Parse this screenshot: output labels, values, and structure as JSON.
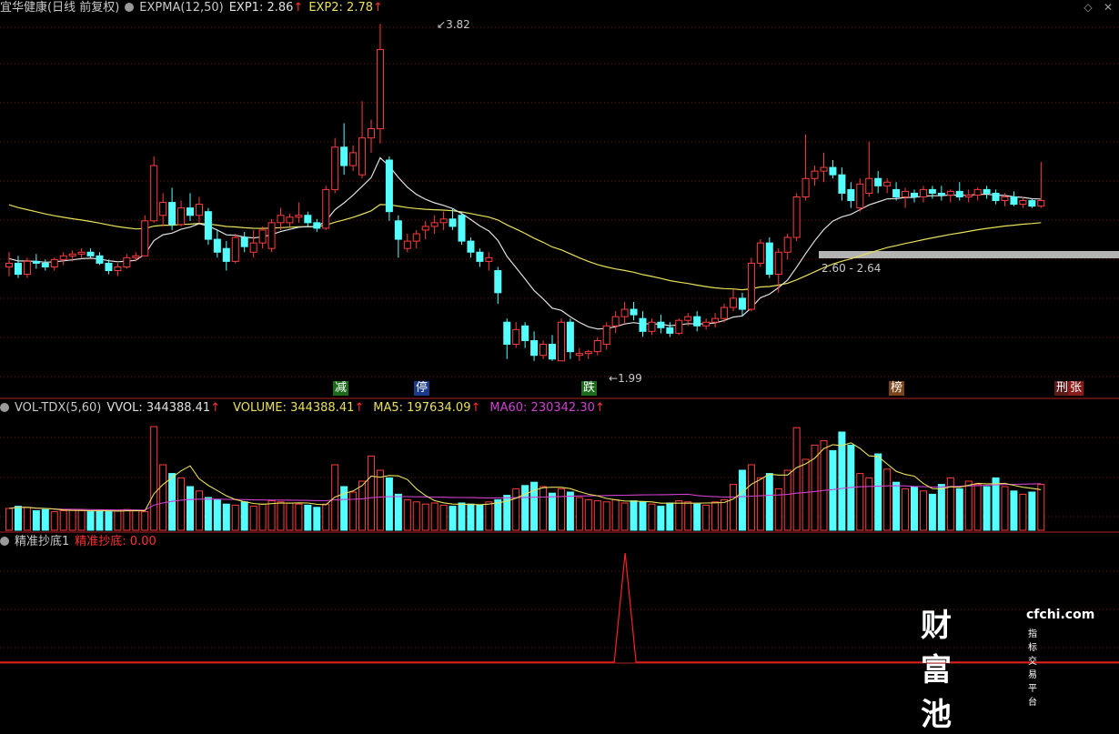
{
  "top_bar": {
    "stock_name": "宜华健康(日线 前复权)",
    "indicator": "EXPMA(12,50)",
    "exp1": "EXP1: 2.86",
    "exp2": "EXP2: 2.78",
    "up_arrow": "↑",
    "max_icon": "max-icon",
    "close_icon": "close-icon"
  },
  "price_annotations": {
    "high": "3.82",
    "low": "1.99",
    "range": "2.60 - 2.64"
  },
  "event_markers": [
    {
      "label": "减",
      "kind": "reduce"
    },
    {
      "label": "停",
      "kind": "halt"
    },
    {
      "label": "跌",
      "kind": "drop"
    },
    {
      "label": "榜",
      "kind": "list"
    },
    {
      "label": "刑",
      "kind": "penal"
    },
    {
      "label": "张",
      "kind": "rise"
    }
  ],
  "volume_bar": {
    "indicator": "VOL-TDX(5,60)",
    "vvol": "VVOL: 344388.41",
    "volume": "VOLUME: 344388.41",
    "ma5": "MA5: 197634.09",
    "ma60": "MA60: 230342.30"
  },
  "signal_bar": {
    "indicator": "精准抄底1",
    "value": "精准抄底: 0.00"
  },
  "watermark": {
    "brand": "财富池",
    "url": "cfchi.com",
    "tagline": "指标交易平台"
  },
  "colors": {
    "up": "#ff3c3c",
    "down": "#54ffff",
    "exp1": "#e0e0e0",
    "exp2": "#e8e05a",
    "ma60": "#d040d0",
    "signal": "#ff2020",
    "highlight_band": "#b4b4b4"
  },
  "chart_data": {
    "type": "candlestick",
    "ohlc": [
      [
        2.5,
        2.58,
        2.45,
        2.52
      ],
      [
        2.52,
        2.56,
        2.44,
        2.46
      ],
      [
        2.46,
        2.55,
        2.44,
        2.53
      ],
      [
        2.53,
        2.57,
        2.49,
        2.52
      ],
      [
        2.52,
        2.54,
        2.48,
        2.5
      ],
      [
        2.5,
        2.55,
        2.48,
        2.54
      ],
      [
        2.54,
        2.58,
        2.51,
        2.56
      ],
      [
        2.56,
        2.59,
        2.53,
        2.57
      ],
      [
        2.57,
        2.6,
        2.55,
        2.58
      ],
      [
        2.58,
        2.6,
        2.55,
        2.56
      ],
      [
        2.56,
        2.58,
        2.51,
        2.52
      ],
      [
        2.52,
        2.54,
        2.46,
        2.48
      ],
      [
        2.48,
        2.52,
        2.45,
        2.5
      ],
      [
        2.5,
        2.57,
        2.49,
        2.55
      ],
      [
        2.55,
        2.58,
        2.53,
        2.56
      ],
      [
        2.56,
        2.78,
        2.56,
        2.75
      ],
      [
        2.75,
        3.1,
        2.74,
        3.05
      ],
      [
        2.78,
        2.9,
        2.72,
        2.85
      ],
      [
        2.85,
        2.93,
        2.7,
        2.73
      ],
      [
        2.73,
        2.86,
        2.72,
        2.82
      ],
      [
        2.82,
        2.9,
        2.75,
        2.78
      ],
      [
        2.78,
        2.88,
        2.74,
        2.84
      ],
      [
        2.8,
        2.82,
        2.62,
        2.65
      ],
      [
        2.65,
        2.7,
        2.55,
        2.58
      ],
      [
        2.6,
        2.64,
        2.48,
        2.53
      ],
      [
        2.53,
        2.68,
        2.52,
        2.66
      ],
      [
        2.66,
        2.69,
        2.58,
        2.61
      ],
      [
        2.58,
        2.7,
        2.55,
        2.63
      ],
      [
        2.63,
        2.72,
        2.6,
        2.7
      ],
      [
        2.6,
        2.76,
        2.58,
        2.74
      ],
      [
        2.74,
        2.82,
        2.7,
        2.78
      ],
      [
        2.74,
        2.79,
        2.72,
        2.77
      ],
      [
        2.77,
        2.85,
        2.74,
        2.78
      ],
      [
        2.78,
        2.8,
        2.72,
        2.74
      ],
      [
        2.74,
        2.76,
        2.69,
        2.71
      ],
      [
        2.71,
        2.94,
        2.7,
        2.92
      ],
      [
        2.92,
        3.2,
        2.9,
        3.15
      ],
      [
        3.15,
        3.28,
        3.0,
        3.05
      ],
      [
        3.05,
        3.16,
        3.02,
        3.12
      ],
      [
        3.0,
        3.4,
        2.98,
        3.2
      ],
      [
        3.2,
        3.3,
        3.12,
        3.25
      ],
      [
        3.25,
        3.82,
        3.17,
        3.68
      ],
      [
        3.08,
        3.1,
        2.75,
        2.8
      ],
      [
        2.75,
        2.78,
        2.55,
        2.65
      ],
      [
        2.6,
        2.68,
        2.58,
        2.64
      ],
      [
        2.64,
        2.7,
        2.6,
        2.68
      ],
      [
        2.7,
        2.75,
        2.65,
        2.72
      ],
      [
        2.72,
        2.78,
        2.68,
        2.74
      ],
      [
        2.74,
        2.8,
        2.7,
        2.76
      ],
      [
        2.76,
        2.82,
        2.7,
        2.72
      ],
      [
        2.78,
        2.8,
        2.62,
        2.64
      ],
      [
        2.64,
        2.66,
        2.55,
        2.58
      ],
      [
        2.58,
        2.6,
        2.5,
        2.53
      ],
      [
        2.53,
        2.58,
        2.48,
        2.55
      ],
      [
        2.48,
        2.5,
        2.3,
        2.36
      ],
      [
        2.2,
        2.22,
        2.0,
        2.08
      ],
      [
        2.08,
        2.2,
        2.06,
        2.16
      ],
      [
        2.18,
        2.2,
        2.06,
        2.1
      ],
      [
        2.1,
        2.15,
        1.99,
        2.02
      ],
      [
        2.02,
        2.1,
        2.0,
        2.08
      ],
      [
        2.08,
        2.13,
        1.99,
        2.0
      ],
      [
        1.99,
        2.22,
        1.99,
        2.2
      ],
      [
        2.2,
        2.22,
        2.0,
        2.04
      ],
      [
        2.02,
        2.06,
        1.99,
        2.03
      ],
      [
        2.03,
        2.05,
        2.0,
        2.04
      ],
      [
        2.04,
        2.12,
        2.02,
        2.1
      ],
      [
        2.08,
        2.2,
        2.05,
        2.18
      ],
      [
        2.18,
        2.26,
        2.14,
        2.23
      ],
      [
        2.23,
        2.31,
        2.19,
        2.27
      ],
      [
        2.27,
        2.31,
        2.21,
        2.24
      ],
      [
        2.22,
        2.26,
        2.12,
        2.15
      ],
      [
        2.15,
        2.22,
        2.13,
        2.2
      ],
      [
        2.2,
        2.24,
        2.14,
        2.17
      ],
      [
        2.17,
        2.2,
        2.12,
        2.14
      ],
      [
        2.14,
        2.22,
        2.13,
        2.21
      ],
      [
        2.21,
        2.25,
        2.18,
        2.23
      ],
      [
        2.23,
        2.26,
        2.15,
        2.18
      ],
      [
        2.18,
        2.22,
        2.16,
        2.2
      ],
      [
        2.2,
        2.25,
        2.17,
        2.22
      ],
      [
        2.22,
        2.3,
        2.2,
        2.28
      ],
      [
        2.28,
        2.38,
        2.26,
        2.33
      ],
      [
        2.33,
        2.36,
        2.23,
        2.27
      ],
      [
        2.27,
        2.55,
        2.26,
        2.52
      ],
      [
        2.52,
        2.65,
        2.5,
        2.63
      ],
      [
        2.63,
        2.66,
        2.44,
        2.46
      ],
      [
        2.46,
        2.6,
        2.36,
        2.58
      ],
      [
        2.58,
        2.68,
        2.54,
        2.66
      ],
      [
        2.66,
        2.9,
        2.64,
        2.88
      ],
      [
        2.88,
        3.22,
        2.86,
        2.98
      ],
      [
        2.98,
        3.05,
        2.94,
        3.02
      ],
      [
        3.02,
        3.12,
        2.96,
        3.04
      ],
      [
        3.04,
        3.08,
        2.98,
        3.0
      ],
      [
        3.0,
        3.04,
        2.86,
        2.9
      ],
      [
        2.92,
        2.96,
        2.82,
        2.86
      ],
      [
        2.82,
        2.98,
        2.8,
        2.95
      ],
      [
        2.9,
        3.18,
        2.88,
        2.98
      ],
      [
        2.98,
        3.02,
        2.9,
        2.94
      ],
      [
        2.94,
        2.98,
        2.9,
        2.96
      ],
      [
        2.92,
        2.96,
        2.86,
        2.88
      ],
      [
        2.88,
        2.93,
        2.82,
        2.91
      ],
      [
        2.9,
        2.92,
        2.85,
        2.88
      ],
      [
        2.88,
        2.94,
        2.85,
        2.92
      ],
      [
        2.92,
        2.94,
        2.87,
        2.9
      ],
      [
        2.9,
        2.94,
        2.86,
        2.89
      ],
      [
        2.89,
        2.92,
        2.85,
        2.91
      ],
      [
        2.91,
        2.96,
        2.86,
        2.88
      ],
      [
        2.88,
        2.92,
        2.85,
        2.89
      ],
      [
        2.89,
        2.93,
        2.86,
        2.92
      ],
      [
        2.92,
        2.94,
        2.87,
        2.9
      ],
      [
        2.9,
        2.92,
        2.84,
        2.86
      ],
      [
        2.86,
        2.9,
        2.83,
        2.88
      ],
      [
        2.88,
        2.91,
        2.83,
        2.84
      ],
      [
        2.84,
        2.88,
        2.82,
        2.86
      ],
      [
        2.86,
        2.87,
        2.82,
        2.83
      ],
      [
        2.83,
        3.07,
        2.82,
        2.86
      ]
    ],
    "volume": [
      20,
      22,
      21,
      18,
      19,
      17,
      18,
      19,
      18,
      17,
      18,
      17,
      18,
      19,
      18,
      17,
      95,
      60,
      52,
      48,
      40,
      36,
      30,
      28,
      24,
      23,
      26,
      22,
      24,
      27,
      26,
      25,
      24,
      23,
      21,
      24,
      60,
      40,
      35,
      45,
      68,
      55,
      48,
      33,
      28,
      26,
      24,
      25,
      23,
      22,
      25,
      24,
      23,
      26,
      28,
      32,
      38,
      41,
      44,
      40,
      34,
      38,
      35,
      30,
      28,
      27,
      26,
      28,
      25,
      27,
      26,
      24,
      22,
      25,
      27,
      26,
      24,
      23,
      26,
      28,
      42,
      55,
      60,
      48,
      52,
      38,
      55,
      94,
      65,
      78,
      82,
      73,
      90,
      78,
      52,
      48,
      70,
      56,
      44,
      38,
      40,
      36,
      33,
      42,
      48,
      38,
      45,
      42,
      40,
      48,
      40,
      36,
      33,
      35,
      42
    ],
    "signal": {
      "peak_index": 57,
      "value": 1
    }
  }
}
